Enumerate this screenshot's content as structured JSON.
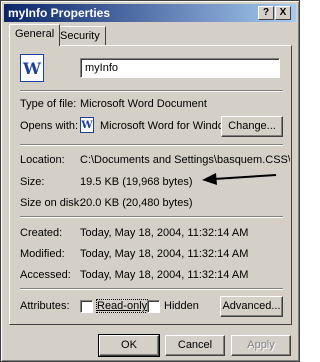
{
  "window": {
    "title": "myInfo Properties",
    "help_button": "?",
    "close_button": "X"
  },
  "tabs": [
    {
      "label": "General",
      "active": true
    },
    {
      "label": "Security",
      "active": false
    }
  ],
  "general": {
    "file_icon": "word-document-icon",
    "file_name": "myInfo",
    "type_label": "Type of file:",
    "type_value": "Microsoft Word Document",
    "opens_label": "Opens with:",
    "opens_icon": "word-app-icon",
    "opens_value": "Microsoft Word for Windows",
    "change_button": "Change...",
    "location_label": "Location:",
    "location_value": "C:\\Documents and Settings\\basquem.CSS\\Desktop",
    "size_label": "Size:",
    "size_value": "19.5 KB (19,968 bytes)",
    "size_on_disk_label": "Size on disk:",
    "size_on_disk_value": "20.0 KB (20,480 bytes)",
    "created_label": "Created:",
    "created_value": "Today, May 18, 2004, 11:32:14 AM",
    "modified_label": "Modified:",
    "modified_value": "Today, May 18, 2004, 11:32:14 AM",
    "accessed_label": "Accessed:",
    "accessed_value": "Today, May 18, 2004, 11:32:14 AM",
    "attributes_label": "Attributes:",
    "readonly_label": "Read-only",
    "readonly_checked": false,
    "hidden_label": "Hidden",
    "hidden_checked": false,
    "advanced_button": "Advanced..."
  },
  "footer": {
    "ok_button": "OK",
    "cancel_button": "Cancel",
    "apply_button": "Apply"
  },
  "annotation": {
    "arrow_icon": "arrow-left-icon"
  },
  "colors": {
    "title_start": "#0a246a",
    "title_end": "#a6caf0",
    "face": "#d4d0c8"
  }
}
